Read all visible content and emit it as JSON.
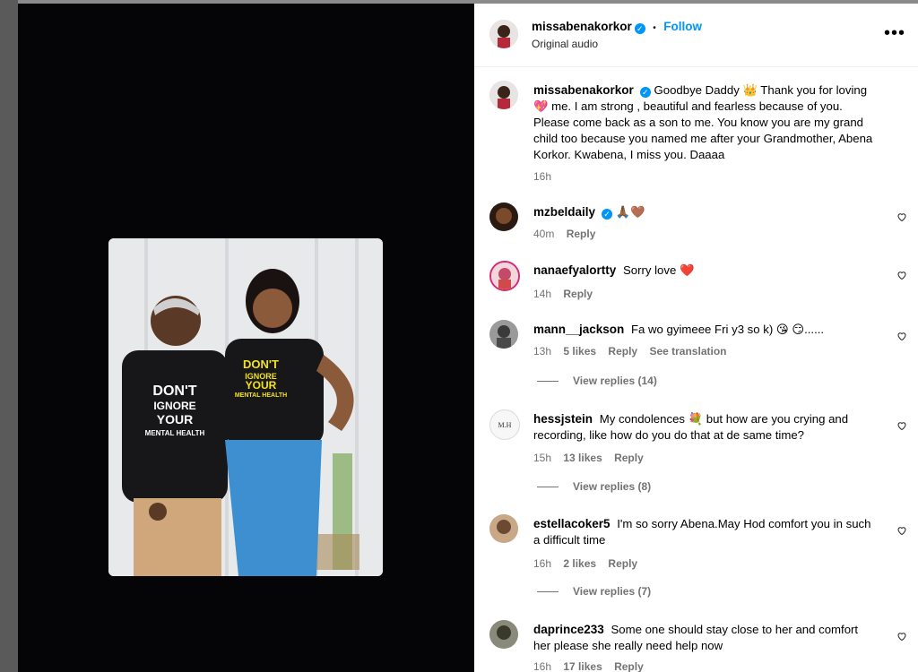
{
  "header": {
    "username": "missabenakorkor",
    "follow_label": "Follow",
    "separator": "•",
    "audio": "Original audio",
    "more_label": "•••"
  },
  "caption": {
    "username": "missabenakorkor",
    "text_line1": "Goodbye Daddy 👑 Thank you for loving",
    "text_line2": "💖 me. I am strong , beautiful and fearless because of you.",
    "text_line3": "Please come back as a son to me. You know you are my grand",
    "text_line4": "child too because you named me after your Grandmother, Abena",
    "text_line5": "Korkor. Kwabena, I miss you. Daaaa",
    "time": "16h"
  },
  "photo": {
    "shirt_text_left": [
      "DON'T",
      "IGNORE",
      "YOUR",
      "MENTAL HEALTH"
    ],
    "shirt_text_right": [
      "DON'T",
      "IGNORE",
      "YOUR",
      "MENTAL HEALTH"
    ]
  },
  "comments": [
    {
      "username": "mzbeldaily",
      "verified": true,
      "text": "🙏🏾🤎",
      "time": "40m",
      "likes": "",
      "reply": "Reply",
      "translate": "",
      "avatar_color": "#7a4a2a"
    },
    {
      "username": "nanaefyalortty",
      "verified": false,
      "text": "Sorry love ❤️",
      "time": "14h",
      "likes": "",
      "reply": "Reply",
      "translate": "",
      "avatar_color": "#c44a6a"
    },
    {
      "username": "mann__jackson",
      "verified": false,
      "text": "Fa wo gyimeee Fri y3 so k) 😘 😏......",
      "time": "13h",
      "likes": "5 likes",
      "reply": "Reply",
      "translate": "See translation",
      "avatar_color": "#4a4a4a"
    },
    {
      "username": "hessjstein",
      "verified": false,
      "text_line1": "My condolences 💐  but how are you crying and",
      "text_line2": "recording, like how do you do that at de same time?",
      "time": "15h",
      "likes": "13 likes",
      "reply": "Reply",
      "translate": "",
      "avatar_color": "#f3f3f3"
    },
    {
      "username": "estellacoker5",
      "verified": false,
      "text_line1": "I'm so sorry Abena.May Hod comfort you in such",
      "text_line2": "a difficult time",
      "time": "16h",
      "likes": "2 likes",
      "reply": "Reply",
      "translate": "",
      "avatar_color": "#8a6a4a"
    },
    {
      "username": "daprince233",
      "verified": false,
      "text_line1": "Some one should stay close to her and comfort",
      "text_line2": "her please she really need help now",
      "time": "16h",
      "likes": "17 likes",
      "reply": "Reply",
      "translate": "",
      "avatar_color": "#5a5a4a"
    }
  ],
  "view_replies": [
    "View replies (14)",
    "View replies (8)",
    "View replies (7)"
  ],
  "icons": {
    "verified": "verified-badge-icon",
    "heart": "heart-outline-icon",
    "more": "more-options-icon"
  },
  "colors": {
    "accent": "#0095f6",
    "muted": "#737373",
    "media_bg": "#050508"
  }
}
